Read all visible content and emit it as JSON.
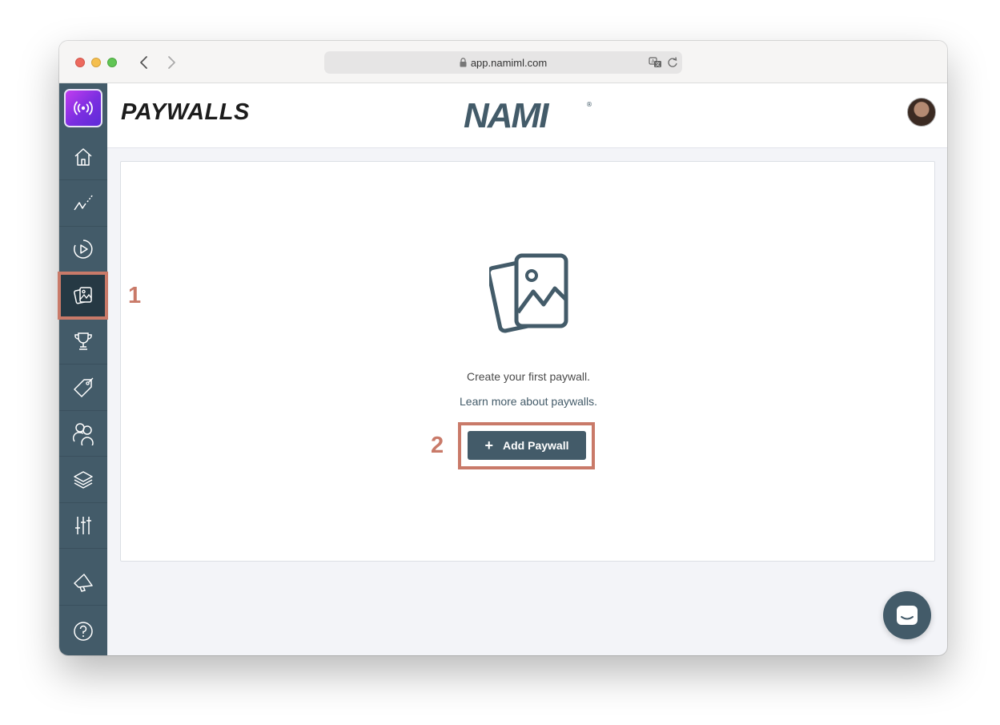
{
  "browser": {
    "url": "app.namiml.com"
  },
  "header": {
    "title": "PAYWALLS",
    "brand": "NAMI"
  },
  "sidebar": {
    "items": [
      {
        "name": "home"
      },
      {
        "name": "analytics"
      },
      {
        "name": "campaigns"
      },
      {
        "name": "paywalls",
        "active": true
      },
      {
        "name": "achievements"
      },
      {
        "name": "products"
      },
      {
        "name": "audiences"
      },
      {
        "name": "integrations"
      },
      {
        "name": "settings"
      },
      {
        "name": "announcements"
      },
      {
        "name": "help"
      }
    ]
  },
  "empty_state": {
    "message": "Create your first paywall.",
    "link": "Learn more about paywalls.",
    "button_label": "Add Paywall",
    "button_icon": "+"
  },
  "annotations": {
    "step1": "1",
    "step2": "2"
  },
  "colors": {
    "sidebar": "#435b69",
    "sidebar_active": "#263944",
    "accent": "#435b69",
    "highlight": "#c97a69"
  }
}
